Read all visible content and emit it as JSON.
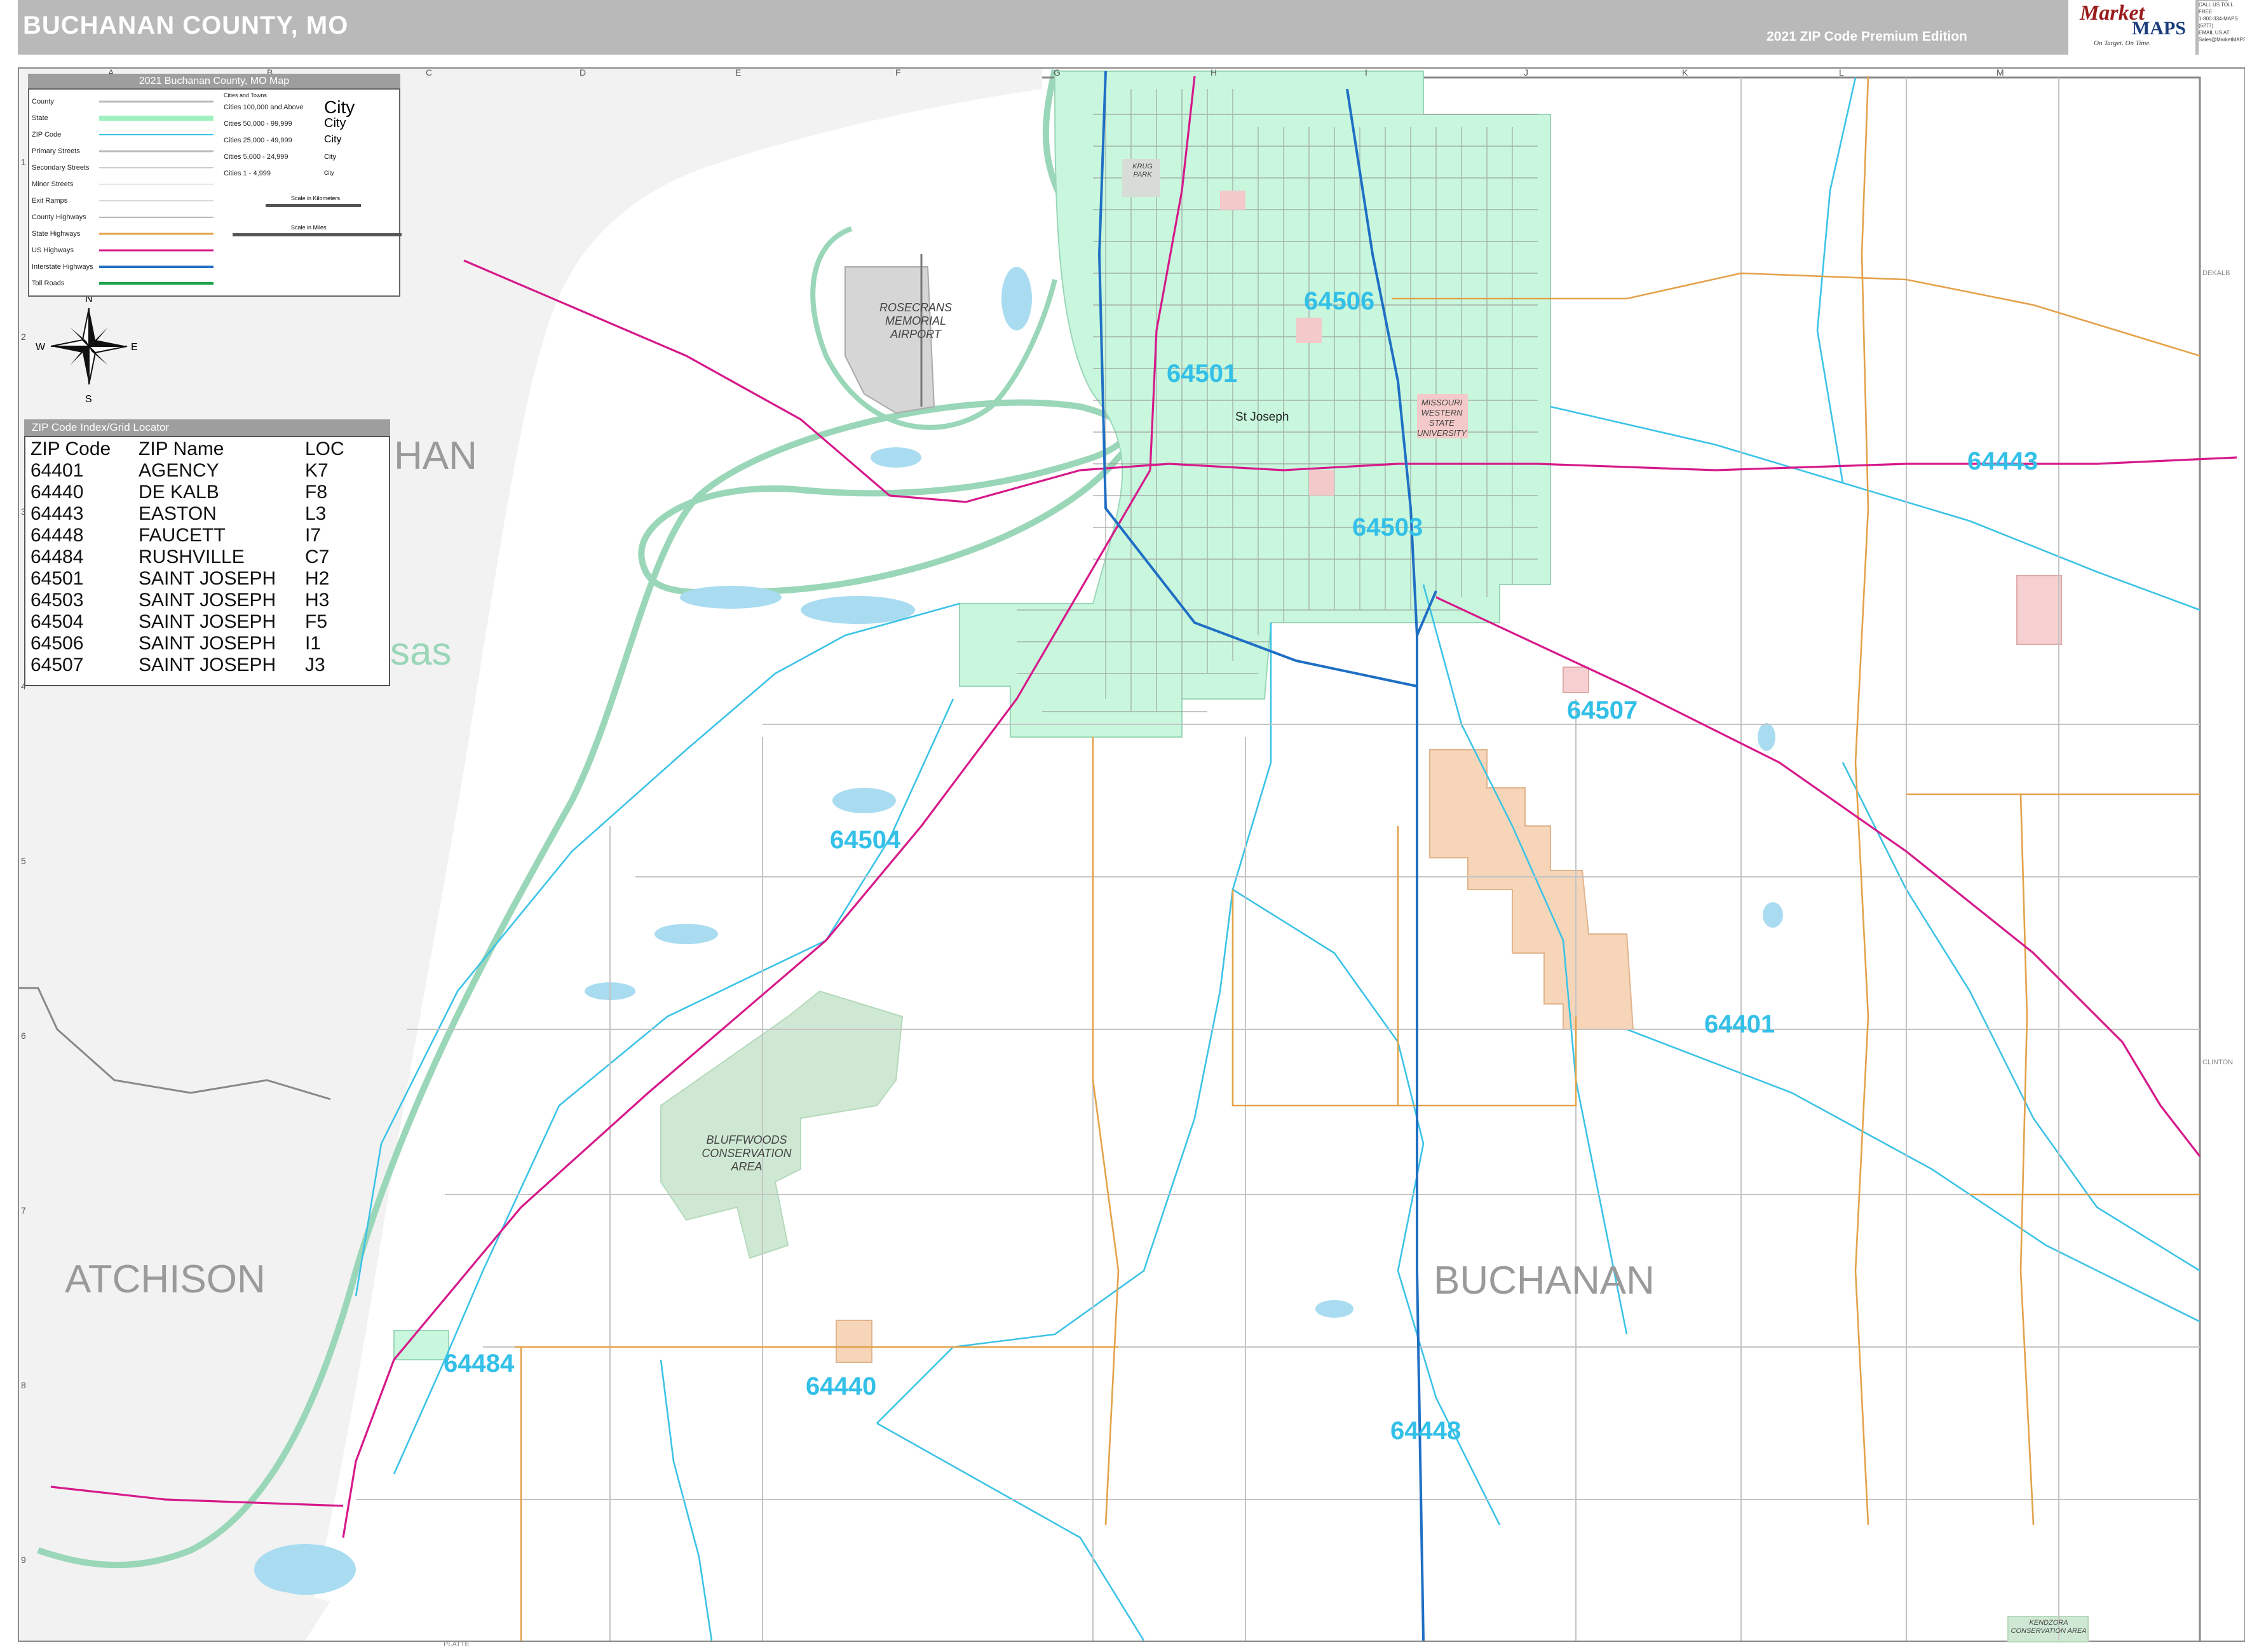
{
  "header": {
    "title": "BUCHANAN COUNTY, MO",
    "edition": "2021 ZIP Code Premium Edition",
    "logo": {
      "word1": "Market",
      "word2": "MAPS",
      "tagline": "On Target. On Time."
    },
    "contact": [
      "CALL US TOLL FREE",
      "1-800-334-MAPS (6277)",
      "EMAIL US AT",
      "Sales@MarketMAPS.com"
    ]
  },
  "grid": {
    "columns": [
      "A",
      "B",
      "C",
      "D",
      "E",
      "F",
      "G",
      "H",
      "I",
      "J",
      "K",
      "L",
      "M"
    ],
    "rows": [
      "1",
      "2",
      "3",
      "4",
      "5",
      "6",
      "7",
      "8",
      "9"
    ]
  },
  "legend": {
    "title": "2021 Buchanan County, MO Map",
    "rows": [
      "County",
      "State",
      "ZIP Code",
      "Primary Streets",
      "Secondary Streets",
      "Minor Streets",
      "Exit Ramps",
      "County Highways",
      "State Highways",
      "US Highways",
      "Interstate Highways",
      "Toll Roads"
    ],
    "cities_header": "Cities and Towns",
    "cities": [
      {
        "label": "Cities 100,000 and Above",
        "sample": "City"
      },
      {
        "label": "Cities 50,000 - 99,999",
        "sample": "City"
      },
      {
        "label": "Cities 25,000 - 49,999",
        "sample": "City"
      },
      {
        "label": "Cities 5,000 - 24,999",
        "sample": "City"
      },
      {
        "label": "Cities 1 - 4,999",
        "sample": "City"
      }
    ],
    "scale_km": "Scale in Kilometers",
    "scale_mi": "Scale in Miles"
  },
  "compass": {
    "n": "N",
    "s": "S",
    "e": "E",
    "w": "W"
  },
  "zip_index": {
    "title": "ZIP Code Index/Grid Locator",
    "headers": [
      "ZIP Code",
      "ZIP Name",
      "LOC"
    ],
    "rows": [
      [
        "64401",
        "AGENCY",
        "K7"
      ],
      [
        "64440",
        "DE KALB",
        "F8"
      ],
      [
        "64443",
        "EASTON",
        "L3"
      ],
      [
        "64448",
        "FAUCETT",
        "I7"
      ],
      [
        "64484",
        "RUSHVILLE",
        "C7"
      ],
      [
        "64501",
        "SAINT JOSEPH",
        "H2"
      ],
      [
        "64503",
        "SAINT JOSEPH",
        "H3"
      ],
      [
        "64504",
        "SAINT JOSEPH",
        "F5"
      ],
      [
        "64506",
        "SAINT JOSEPH",
        "I1"
      ],
      [
        "64507",
        "SAINT JOSEPH",
        "J3"
      ]
    ]
  },
  "map_labels": {
    "zips": [
      {
        "id": "z64506",
        "text": "64506"
      },
      {
        "id": "z64501",
        "text": "64501"
      },
      {
        "id": "z64503",
        "text": "64503"
      },
      {
        "id": "z64443",
        "text": "64443"
      },
      {
        "id": "z64507",
        "text": "64507"
      },
      {
        "id": "z64504",
        "text": "64504"
      },
      {
        "id": "z64401",
        "text": "64401"
      },
      {
        "id": "z64484",
        "text": "64484"
      },
      {
        "id": "z64440",
        "text": "64440"
      },
      {
        "id": "z64448",
        "text": "64448"
      }
    ],
    "counties": {
      "buchanan": "BUCHANAN",
      "atchison": "ATCHISON",
      "han": "HAN",
      "sas": "sas"
    },
    "city": "St Joseph",
    "areas": {
      "airport": "ROSECRANS MEMORIAL AIRPORT",
      "bluffwoods": "BLUFFWOODS CONSERVATION AREA",
      "msu": "MISSOURI WESTERN STATE UNIVERSITY",
      "kendzora": "KENDZORA CONSERVATION AREA",
      "krug": "KRUG PARK"
    },
    "edge": {
      "dekalb": "DEKALB",
      "clinton": "CLINTON",
      "platte": "PLATTE"
    }
  },
  "colors": {
    "zip_label": "#33c0e8",
    "stjoseph_fill": "#c8f7dd",
    "town_fill": "#f6d5b8",
    "conservation_fill": "#cfe8d3",
    "water": "#a9dcf0",
    "river_outline": "#9ad6b8",
    "interstate": "#1f6fc4",
    "us_highway": "#d6198a",
    "state_highway": "#e3a24a",
    "zip_boundary": "#3bc3e6",
    "outside_state": "#f2f2f2"
  }
}
